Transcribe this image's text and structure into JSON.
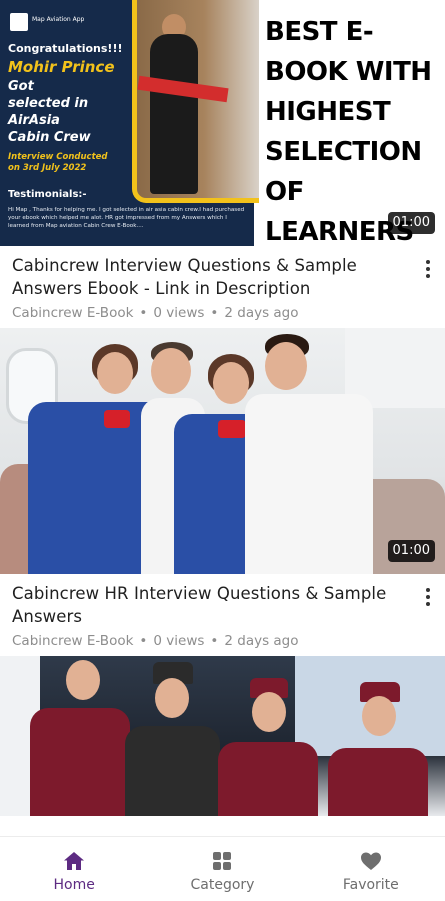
{
  "colors": {
    "accent": "#5d2b82",
    "inactive": "#6e6e6e",
    "subtext": "#8d8d8d"
  },
  "videos": [
    {
      "title": "Cabincrew Interview Questions & Sample Answers Ebook - Link in Description",
      "channel": "Cabincrew E-Book",
      "views": "0 views",
      "age": "2 days ago",
      "duration": "01:00",
      "thumbnail": {
        "logo_text": "Map Aviation App",
        "congrats": "Congratulations!!!",
        "name": "Mohir Prince",
        "selected": "Got\nselected in\nAirAsia\nCabin Crew",
        "interview": "Interview Conducted\non 3rd July 2022",
        "testimonials_heading": "Testimonials:-",
        "testimonials_body": "Hi Map , Thanks for helping me. I got selected in air asia cabin crew.I had purchased your ebook which helped me alot. HR got impressed from my Answers which I learned from Map aviation Cabin Crew E-Book....",
        "headline": "BEST E-BOOK WITH HIGHEST SELECTION OF LEARNERS"
      }
    },
    {
      "title": "Cabincrew HR Interview Questions & Sample Answers",
      "channel": "Cabincrew E-Book",
      "views": "0 views",
      "age": "2 days ago",
      "duration": "01:00"
    },
    {
      "title": "",
      "channel": "",
      "views": "",
      "age": ""
    }
  ],
  "bottom_nav": {
    "items": [
      {
        "label": "Home",
        "icon": "home-icon",
        "active": true
      },
      {
        "label": "Category",
        "icon": "category-icon",
        "active": false
      },
      {
        "label": "Favorite",
        "icon": "heart-icon",
        "active": false
      }
    ]
  }
}
